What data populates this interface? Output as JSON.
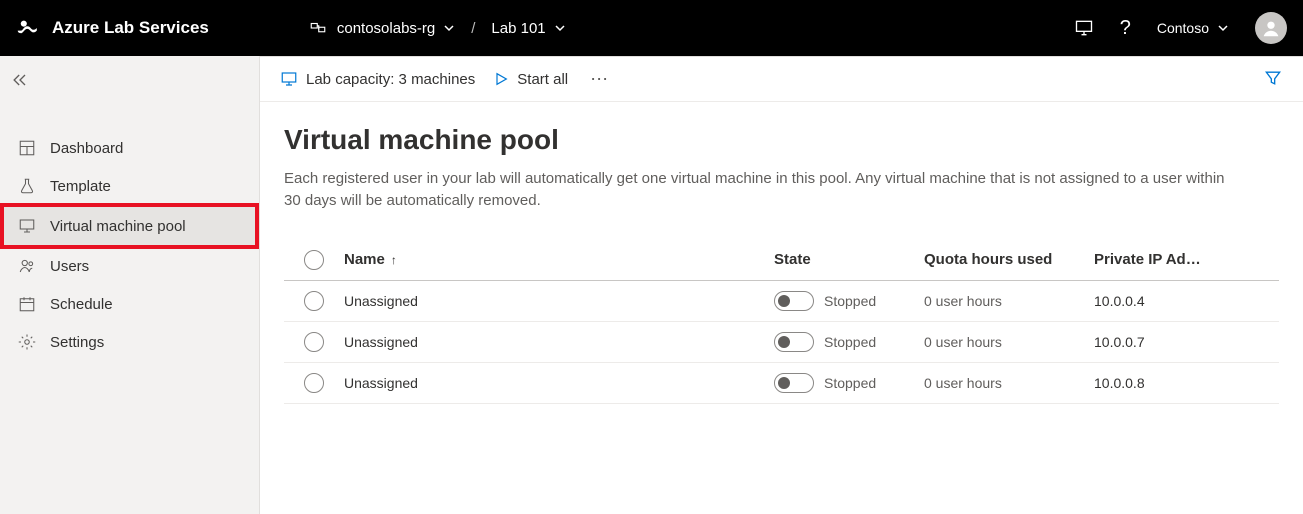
{
  "topbar": {
    "product": "Azure Lab Services",
    "resource_group": "contosolabs-rg",
    "lab_name": "Lab 101",
    "user_label": "Contoso"
  },
  "sidebar": {
    "items": [
      {
        "label": "Dashboard"
      },
      {
        "label": "Template"
      },
      {
        "label": "Virtual machine pool"
      },
      {
        "label": "Users"
      },
      {
        "label": "Schedule"
      },
      {
        "label": "Settings"
      }
    ]
  },
  "commandbar": {
    "capacity": "Lab capacity: 3 machines",
    "start_all": "Start all"
  },
  "page": {
    "title": "Virtual machine pool",
    "description": "Each registered user in your lab will automatically get one virtual machine in this pool. Any virtual machine that is not assigned to a user within 30 days will be automatically removed."
  },
  "table": {
    "headers": {
      "name": "Name",
      "state": "State",
      "quota": "Quota hours used",
      "ip": "Private IP Ad…"
    },
    "rows": [
      {
        "name": "Unassigned",
        "state": "Stopped",
        "quota": "0 user hours",
        "ip": "10.0.0.4"
      },
      {
        "name": "Unassigned",
        "state": "Stopped",
        "quota": "0 user hours",
        "ip": "10.0.0.7"
      },
      {
        "name": "Unassigned",
        "state": "Stopped",
        "quota": "0 user hours",
        "ip": "10.0.0.8"
      }
    ]
  }
}
